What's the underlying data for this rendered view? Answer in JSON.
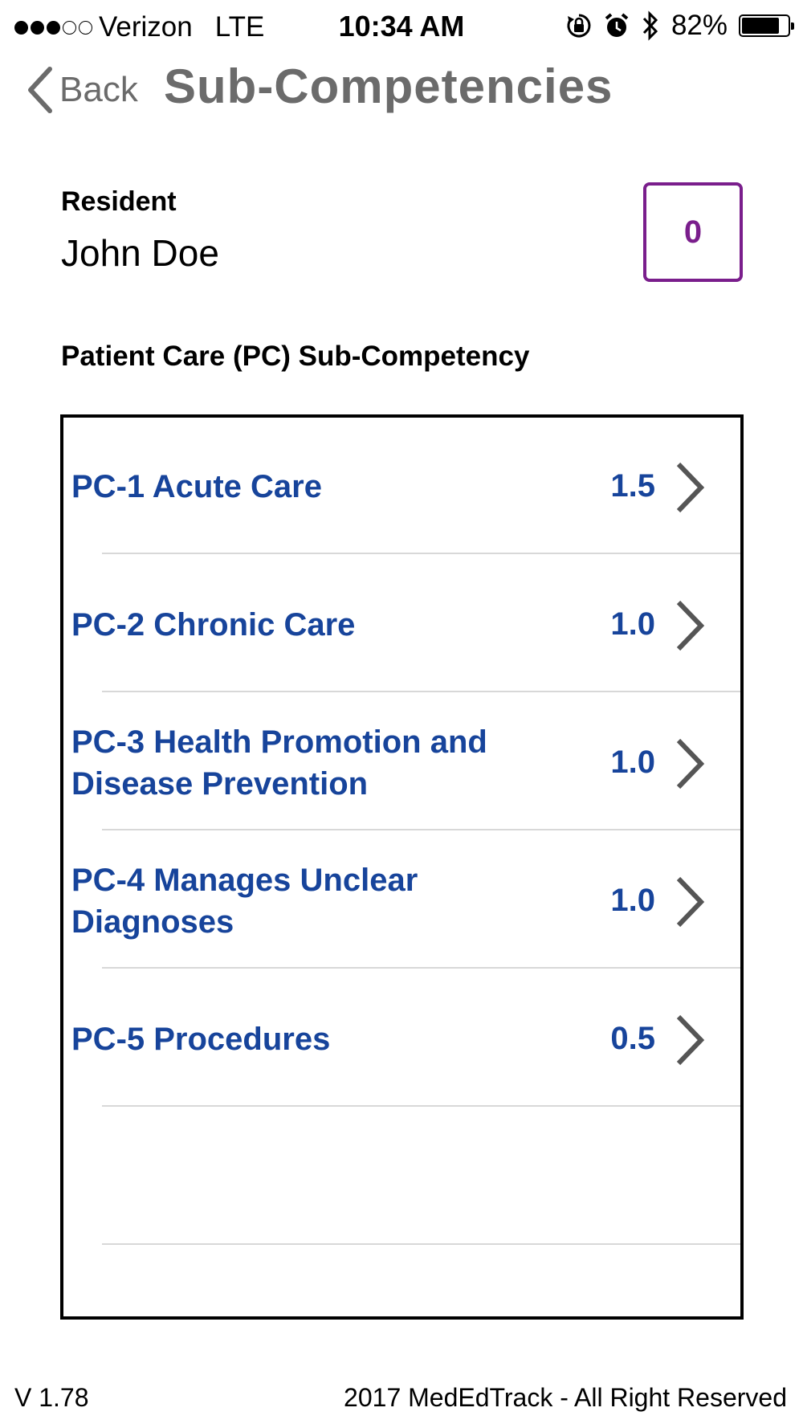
{
  "status_bar": {
    "carrier": "Verizon",
    "network": "LTE",
    "time": "10:34 AM",
    "battery_percent": "82%",
    "battery_level": 0.82,
    "signal_bars_filled": 3,
    "signal_bars_total": 5
  },
  "nav": {
    "back_label": "Back",
    "title": "Sub-Competencies"
  },
  "resident": {
    "label": "Resident",
    "name": "John Doe",
    "score": "0"
  },
  "section": {
    "heading": "Patient Care (PC) Sub-Competency"
  },
  "items": [
    {
      "label": "PC-1 Acute Care",
      "value": "1.5"
    },
    {
      "label": "PC-2 Chronic Care",
      "value": "1.0"
    },
    {
      "label": "PC-3 Health Promotion and Disease Prevention",
      "value": "1.0"
    },
    {
      "label": "PC-4 Manages Unclear Diagnoses",
      "value": "1.0"
    },
    {
      "label": "PC-5 Procedures",
      "value": "0.5"
    }
  ],
  "footer": {
    "version": "V 1.78",
    "copyright": "2017 MedEdTrack - All Right Reserved"
  },
  "colors": {
    "link_blue": "#17449b",
    "accent_purple": "#7a1e8c",
    "nav_gray": "#6b6b6b"
  }
}
